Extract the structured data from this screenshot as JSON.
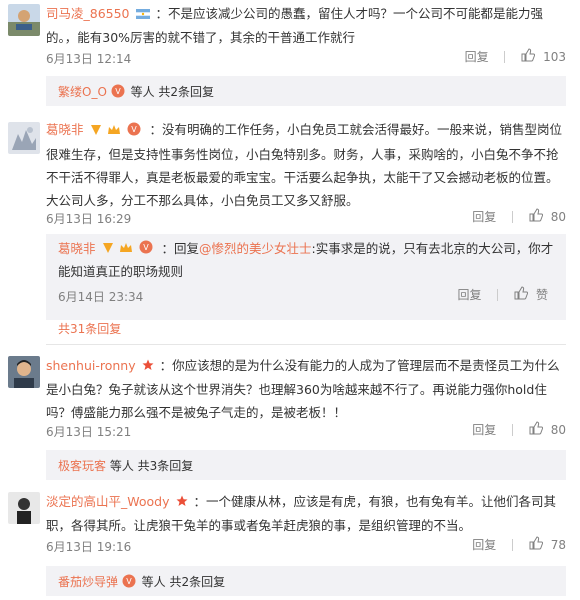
{
  "comments": [
    {
      "user": "司马凌_86550",
      "text": "：不是应该减少公司的愚蠢，留住人才吗？一个公司不可能都是能力强的。，能有30%厉害的就不错了，其余的干普通工作就行",
      "time": "6月13日 12:14",
      "reply": "回复",
      "likes": "103",
      "sub_user": "繁缕O_O",
      "sub_text": "等人 共2条回复"
    },
    {
      "user": "葛晓非",
      "text": "：没有明确的工作任务，小白免员工就会活得最好。一般来说，销售型岗位很难生存，但是支持性事务性岗位，小白兔特别多。财务，人事，采购啥的，小白兔不争不抢不干活不得罪人，真是老板最爱的乖宝宝。干活要么起争执，太能干了又会撼动老板的位置。大公司人多，分工不那么具体，小白免员工又多又舒服。",
      "time": "6月13日 16:29",
      "reply": "回复",
      "likes": "80",
      "nested": {
        "user": "葛晓非",
        "reply_prefix": "：回复",
        "mention": "@惨烈的美少女壮士",
        "text": ":实事求是的说，只有去北京的大公司，你才能知道真正的职场规则",
        "time": "6月14日 23:34",
        "reply": "回复",
        "like": "赞"
      },
      "more": "共31条回复"
    },
    {
      "user": "shenhui-ronny",
      "text": "：你应该想的是为什么没有能力的人成为了管理层而不是责怪员工为什么是小白兔？兔子就该从这个世界消失？也理解360为啥越来越不行了。再说能力强你hold住吗？傅盛能力那么强不是被兔子气走的，是被老板！！",
      "time": "6月13日 15:21",
      "reply": "回复",
      "likes": "80",
      "sub_user": "极客玩客",
      "sub_text": "等人 共3条回复"
    },
    {
      "user": "淡定的高山平_Woody",
      "text": "：一个健康从林，应该是有虎，有狼，也有兔有羊。让他们各司其职，各得其所。让虎狼干兔羊的事或者兔羊赶虎狼的事，是组织管理的不当。",
      "time": "6月13日 19:16",
      "reply": "回复",
      "likes": "78",
      "sub_user": "番茄炒导弹",
      "sub_text": "等人 共2条回复"
    }
  ],
  "colors": {
    "accent": "#eb7350",
    "gray": "#808080",
    "subbar": "#f2f2f5"
  }
}
